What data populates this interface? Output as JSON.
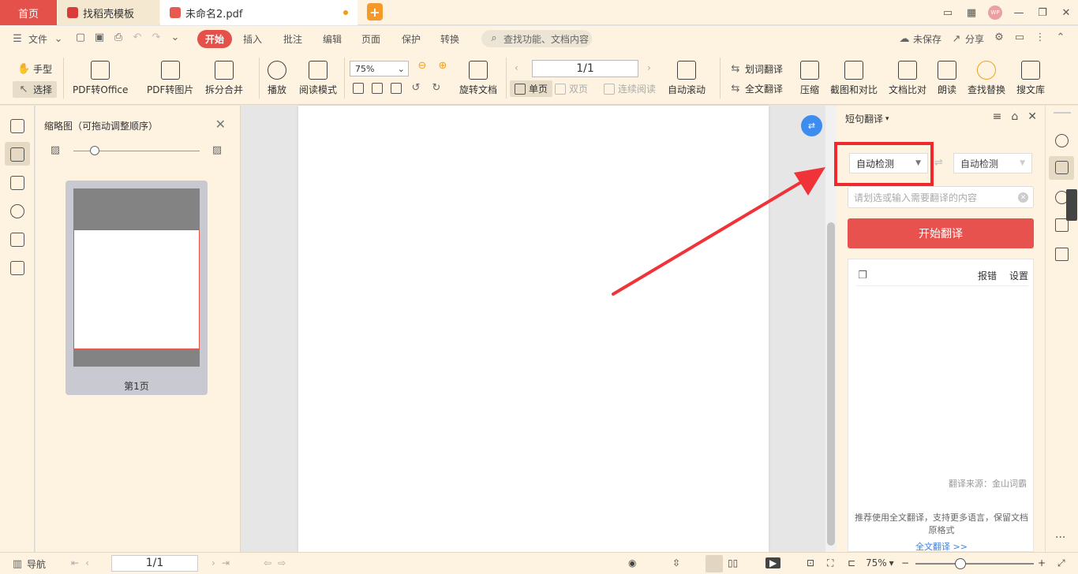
{
  "tabs": {
    "home": "首页",
    "shell_template": "找稻壳模板",
    "document": "未命名2.pdf"
  },
  "window": {
    "avatar_text": "WP"
  },
  "menu": {
    "file": "文件",
    "start": "开始",
    "insert": "插入",
    "annotate": "批注",
    "edit": "编辑",
    "page": "页面",
    "protect": "保护",
    "convert": "转换",
    "search_placeholder": "查找功能、文档内容",
    "unsaved": "未保存",
    "share": "分享"
  },
  "toolbar": {
    "hand": "手型",
    "select": "选择",
    "pdf_to_office": "PDF转Office",
    "pdf_to_image": "PDF转图片",
    "split_merge": "拆分合并",
    "play": "播放",
    "read_mode": "阅读模式",
    "zoom_value": "75%",
    "rotate_doc": "旋转文档",
    "page_value": "1/1",
    "single_page": "单页",
    "double_page": "双页",
    "continuous": "连续阅读",
    "auto_scroll": "自动滚动",
    "word_translate": "划词翻译",
    "full_translate": "全文翻译",
    "compress": "压缩",
    "screenshot_compare": "截图和对比",
    "doc_compare": "文档比对",
    "read_aloud": "朗读",
    "find_replace": "查找替换",
    "search_library": "搜文库"
  },
  "thumbnail_panel": {
    "title": "缩略图（可拖动调整顺序）",
    "page_label": "第1页"
  },
  "translate_panel": {
    "title": "短句翻译",
    "source_lang": "自动检测",
    "target_lang": "自动检测",
    "input_placeholder": "请划选或输入需要翻译的内容",
    "button": "开始翻译",
    "report": "报错",
    "settings": "设置",
    "source_note": "翻译来源：金山词霸",
    "promo": "推荐使用全文翻译，支持更多语言，保留文档原格式",
    "promo_link": "全文翻译 >>"
  },
  "statusbar": {
    "nav": "导航",
    "page_value": "1/1",
    "zoom": "75%"
  },
  "colors": {
    "accent": "#e4514b",
    "highlight": "#f0282e",
    "arrow": "#ef3338",
    "bg_warm": "#fdf3e0"
  }
}
